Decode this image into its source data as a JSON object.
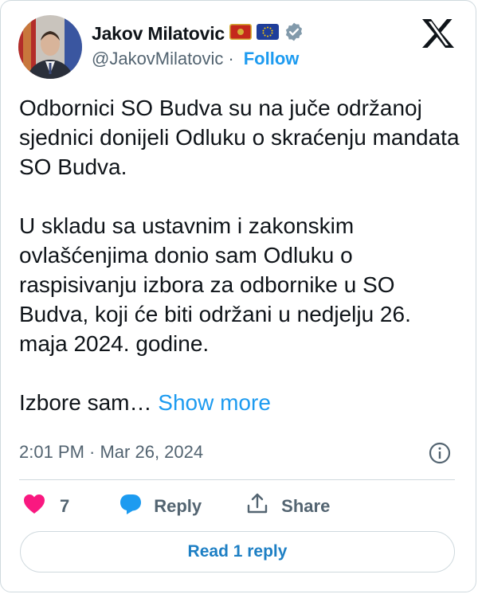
{
  "author": {
    "name": "Jakov Milatovic",
    "handle": "@JakovMilatovic",
    "separator": "·",
    "follow_label": "Follow",
    "flags": [
      "montenegro-flag-icon",
      "eu-flag-icon"
    ],
    "verified_icon": "verified-badge-icon"
  },
  "tweet": {
    "paragraph1": "Odbornici SO Budva su na juče održanoj sjednici donijeli Odluku o skraćenju mandata SO Budva.",
    "paragraph2": "U skladu sa ustavnim i zakonskim ovlašćenjima donio sam Odluku o raspisivanju izbora za odbornike u SO Budva, koji će biti održani u nedjelju 26. maja 2024. godine.",
    "paragraph3_truncated": "Izbore sam…",
    "show_more_label": "Show more",
    "timestamp": "2:01 PM · Mar 26, 2024"
  },
  "actions": {
    "like_count": "7",
    "reply_label": "Reply",
    "share_label": "Share"
  },
  "read_reply_label": "Read 1 reply",
  "colors": {
    "accent": "#1d9bf0",
    "like": "#f91880",
    "muted": "#536471",
    "text": "#0f1419",
    "border": "#cfd9de"
  }
}
